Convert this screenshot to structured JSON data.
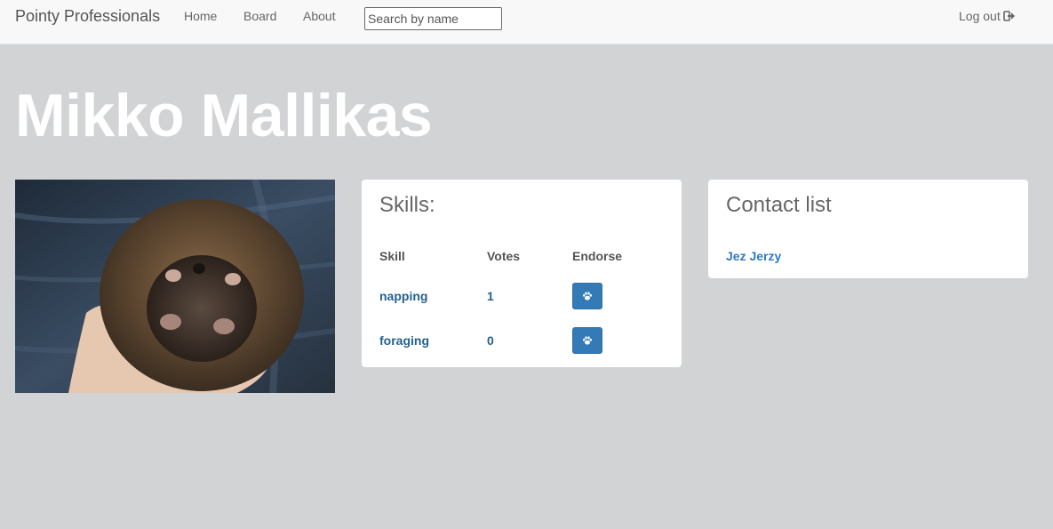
{
  "navbar": {
    "brand": "Pointy Professionals",
    "links": [
      "Home",
      "Board",
      "About"
    ],
    "search_placeholder": "Search by name",
    "search_value": "",
    "logout_label": "Log out"
  },
  "profile": {
    "name": "Mikko Mallikas",
    "photo_alt": "hedgehog held in a hand"
  },
  "skills": {
    "title": "Skills:",
    "headers": [
      "Skill",
      "Votes",
      "Endorse"
    ],
    "rows": [
      {
        "skill": "napping",
        "votes": "1"
      },
      {
        "skill": "foraging",
        "votes": "0"
      }
    ]
  },
  "contacts": {
    "title": "Contact list",
    "items": [
      "Jez Jerzy"
    ]
  },
  "colors": {
    "background": "#d2d3d5",
    "navbar": "#f8f8f8",
    "button": "#337ab7",
    "link": "#23618f"
  }
}
